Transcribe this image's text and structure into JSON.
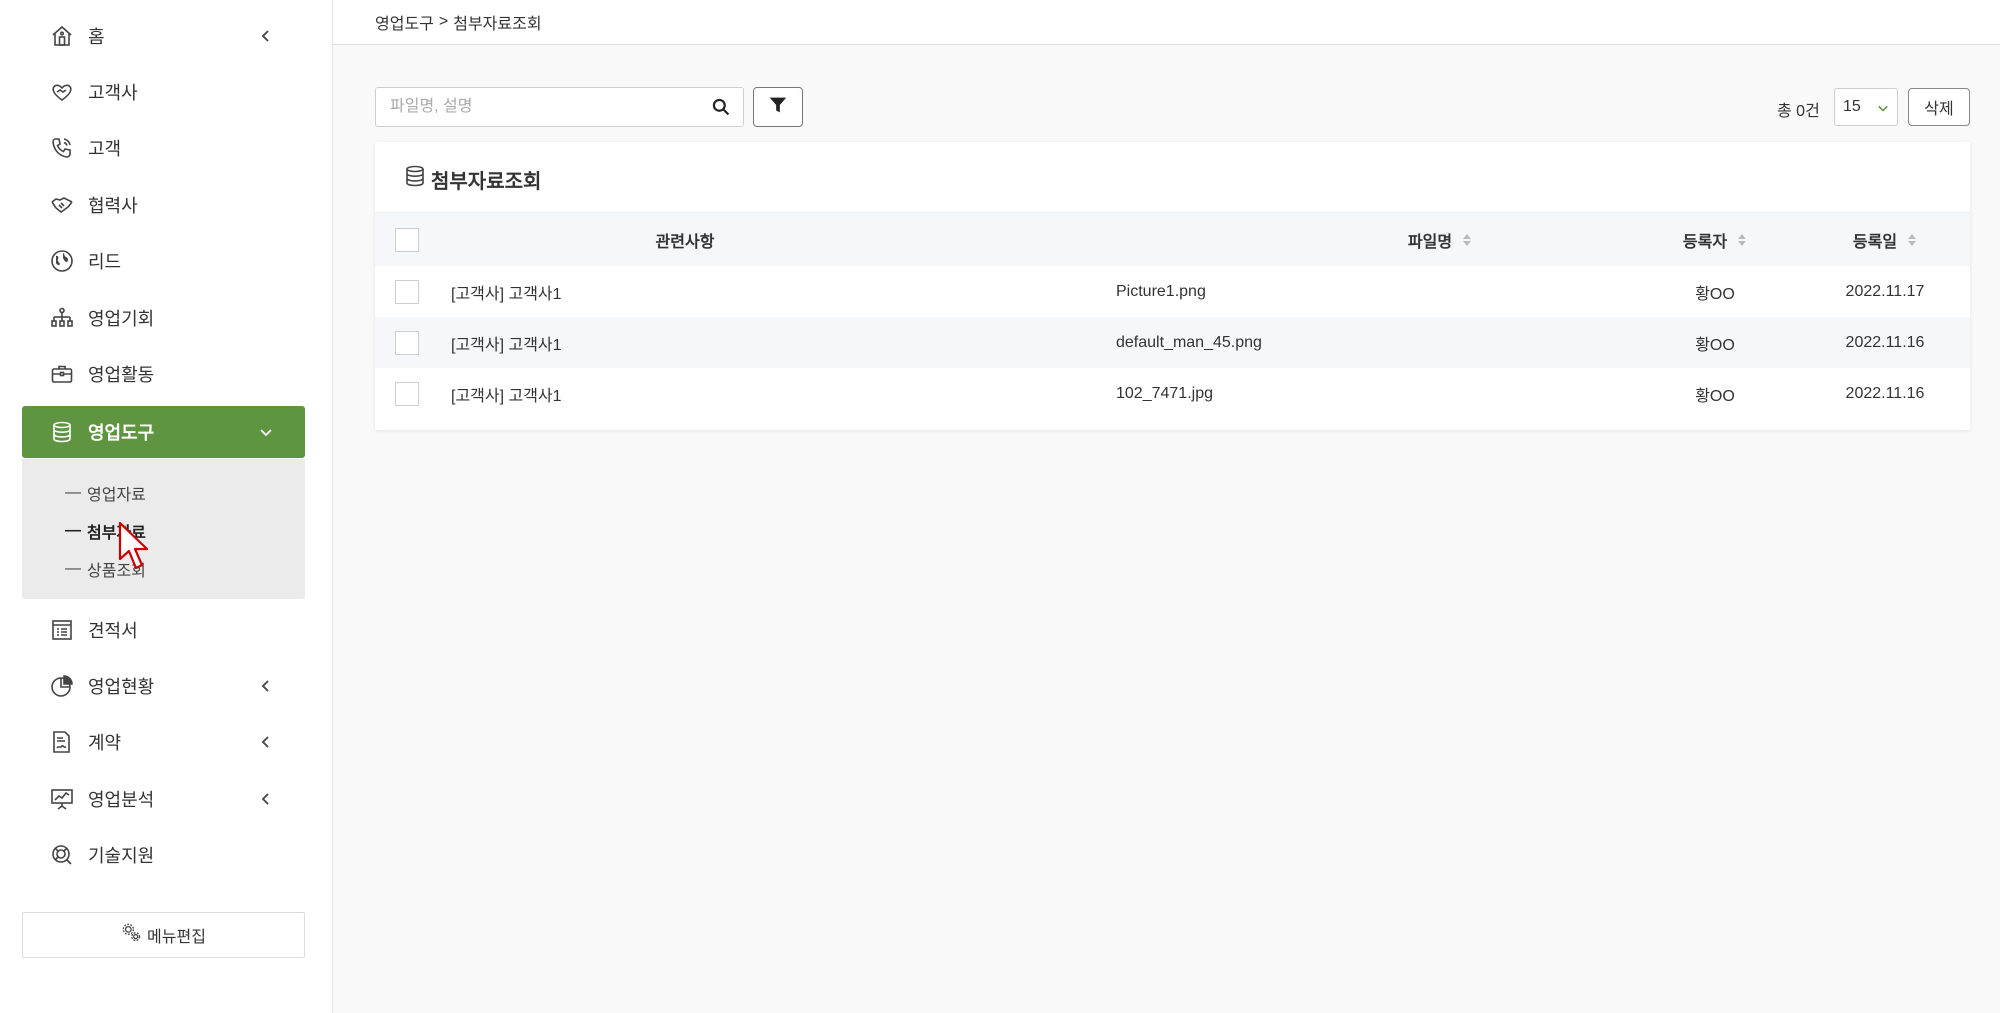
{
  "sidebar": {
    "items": [
      {
        "label": "홈",
        "icon": "home-icon",
        "chevron": "left"
      },
      {
        "label": "고객사",
        "icon": "handshake-heart-icon"
      },
      {
        "label": "고객",
        "icon": "phone-icon"
      },
      {
        "label": "협력사",
        "icon": "handshake-icon"
      },
      {
        "label": "리드",
        "icon": "globe-icon"
      },
      {
        "label": "영업기회",
        "icon": "org-chart-icon"
      },
      {
        "label": "영업활동",
        "icon": "briefcase-icon"
      },
      {
        "label": "영업도구",
        "icon": "database-icon",
        "chevron": "down",
        "active": true
      },
      {
        "label": "견적서",
        "icon": "receipt-icon"
      },
      {
        "label": "영업현황",
        "icon": "pie-chart-icon",
        "chevron": "left"
      },
      {
        "label": "계약",
        "icon": "contract-icon",
        "chevron": "left"
      },
      {
        "label": "영업분석",
        "icon": "presentation-icon",
        "chevron": "left"
      },
      {
        "label": "기술지원",
        "icon": "support-icon"
      }
    ],
    "submenu": [
      {
        "label": "영업자료"
      },
      {
        "label": "첨부자료",
        "current": true
      },
      {
        "label": "상품조회"
      }
    ],
    "menu_edit_label": "메뉴편집"
  },
  "breadcrumb": {
    "parent": "영업도구",
    "separator": ">",
    "current": "첨부자료조회"
  },
  "toolbar": {
    "search_placeholder": "파일명, 설명",
    "search_value": "",
    "total_label": "총 0건",
    "page_size": "15",
    "delete_label": "삭제"
  },
  "card": {
    "title": "첨부자료조회",
    "columns": [
      "관련사항",
      "파일명",
      "등록자",
      "등록일"
    ],
    "rows": [
      {
        "related": "[고객사] 고객사1",
        "filename": "Picture1.png",
        "registrant": "황OO",
        "date": "2022.11.17"
      },
      {
        "related": "[고객사] 고객사1",
        "filename": "default_man_45.png",
        "registrant": "황OO",
        "date": "2022.11.16"
      },
      {
        "related": "[고객사] 고객사1",
        "filename": "102_7471.jpg",
        "registrant": "황OO",
        "date": "2022.11.16"
      }
    ]
  },
  "colors": {
    "accent": "#5f9541",
    "row_alt": "#f5f7fa",
    "page_bg": "#f9f9f9"
  }
}
